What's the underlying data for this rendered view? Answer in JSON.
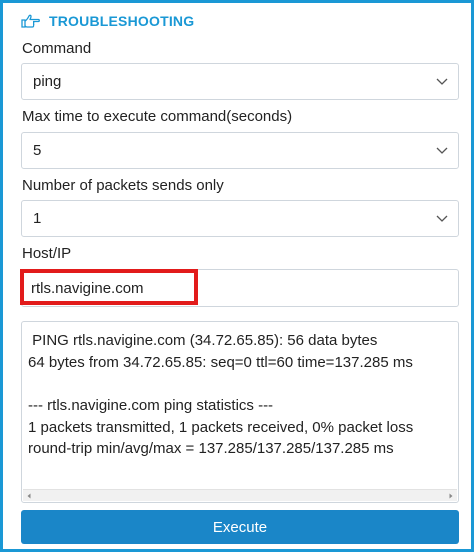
{
  "header": {
    "icon": "pointing-hand-icon",
    "title": "TROUBLESHOOTING"
  },
  "fields": {
    "command": {
      "label": "Command",
      "value": "ping"
    },
    "max_time": {
      "label": "Max time to execute command(seconds)",
      "value": "5"
    },
    "packets": {
      "label": "Number of packets sends only",
      "value": "1"
    },
    "host": {
      "label": "Host/IP",
      "value": "rtls.navigine.com"
    }
  },
  "output": {
    "lines": [
      " PING rtls.navigine.com (34.72.65.85): 56 data bytes",
      "64 bytes from 34.72.65.85: seq=0 ttl=60 time=137.285 ms",
      "",
      "--- rtls.navigine.com ping statistics ---",
      "1 packets transmitted, 1 packets received, 0% packet loss",
      "round-trip min/avg/max = 137.285/137.285/137.285 ms"
    ]
  },
  "actions": {
    "execute_label": "Execute"
  },
  "colors": {
    "accent": "#1a98d5",
    "button": "#1a86c8",
    "highlight": "#e21b1b"
  }
}
